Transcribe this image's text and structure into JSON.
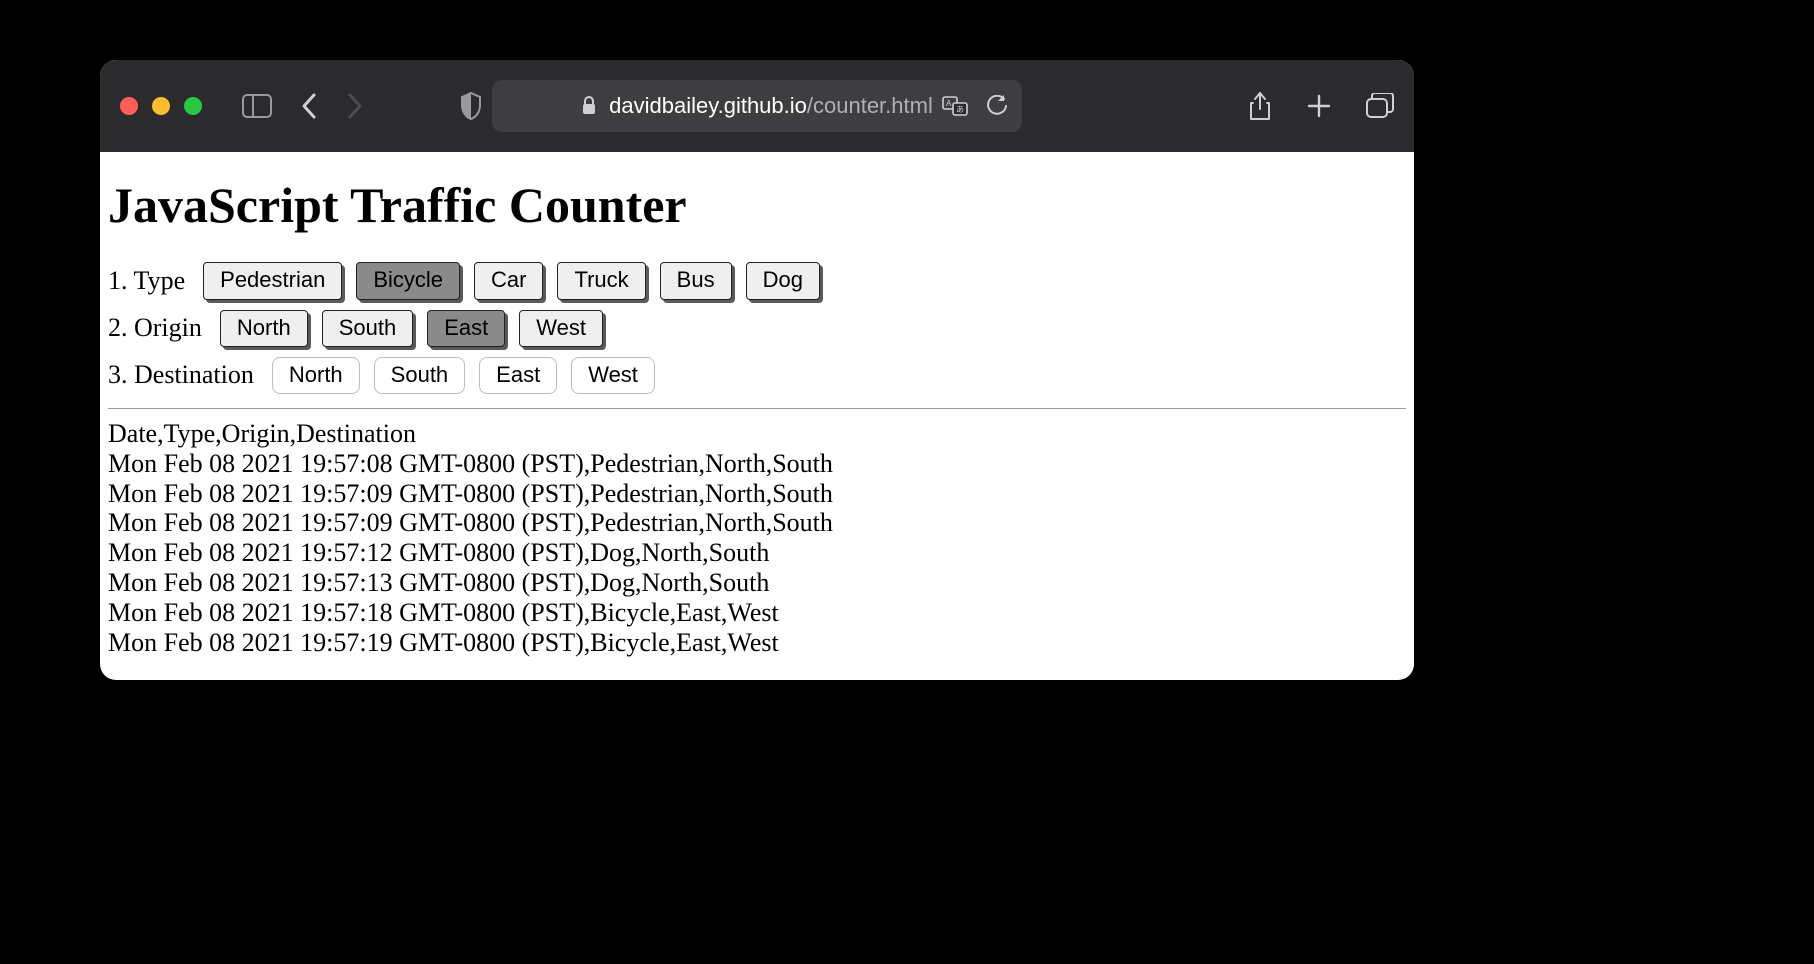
{
  "browser": {
    "url_display_domain": "davidbailey.github.io",
    "url_display_path": "/counter.html"
  },
  "page": {
    "title": "JavaScript Traffic Counter",
    "rows": {
      "type": {
        "label": "1. Type",
        "options": [
          "Pedestrian",
          "Bicycle",
          "Car",
          "Truck",
          "Bus",
          "Dog"
        ],
        "selected": "Bicycle",
        "style": "raised"
      },
      "origin": {
        "label": "2. Origin",
        "options": [
          "North",
          "South",
          "East",
          "West"
        ],
        "selected": "East",
        "style": "raised"
      },
      "destination": {
        "label": "3. Destination",
        "options": [
          "North",
          "South",
          "East",
          "West"
        ],
        "selected": null,
        "style": "plain"
      }
    },
    "log_header": "Date,Type,Origin,Destination",
    "log_entries": [
      "Mon Feb 08 2021 19:57:08 GMT-0800 (PST),Pedestrian,North,South",
      "Mon Feb 08 2021 19:57:09 GMT-0800 (PST),Pedestrian,North,South",
      "Mon Feb 08 2021 19:57:09 GMT-0800 (PST),Pedestrian,North,South",
      "Mon Feb 08 2021 19:57:12 GMT-0800 (PST),Dog,North,South",
      "Mon Feb 08 2021 19:57:13 GMT-0800 (PST),Dog,North,South",
      "Mon Feb 08 2021 19:57:18 GMT-0800 (PST),Bicycle,East,West",
      "Mon Feb 08 2021 19:57:19 GMT-0800 (PST),Bicycle,East,West"
    ]
  }
}
